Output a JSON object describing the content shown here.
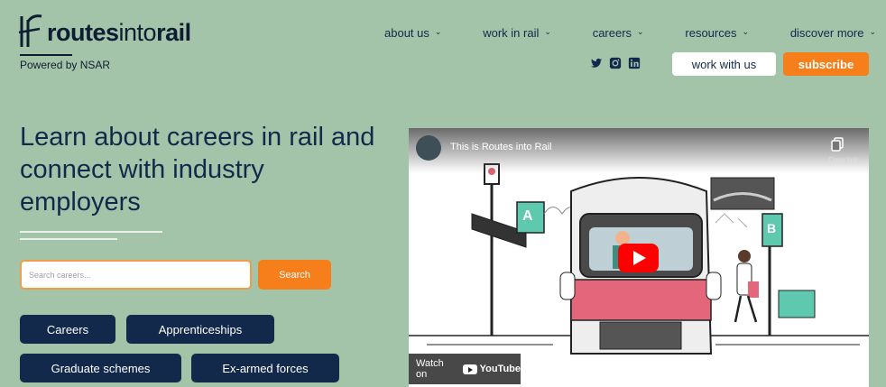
{
  "brand": {
    "name_bold_1": "routes",
    "name_thin": "into",
    "name_bold_2": "rail",
    "powered_by": "Powered by NSAR"
  },
  "nav": {
    "items": [
      {
        "label": "about us"
      },
      {
        "label": "work in rail"
      },
      {
        "label": "careers"
      },
      {
        "label": "resources"
      },
      {
        "label": "discover more"
      }
    ],
    "chevron": "⌄"
  },
  "social": [
    "twitter-icon",
    "instagram-icon",
    "linkedin-icon"
  ],
  "header_buttons": {
    "work_with_us": "work with us",
    "subscribe": "subscribe"
  },
  "hero": {
    "title": "Learn about careers in rail and connect with industry employers"
  },
  "search": {
    "placeholder": "Search careers...",
    "button": "Search"
  },
  "chips": [
    "Careers",
    "Apprenticeships",
    "Graduate schemes",
    "Ex-armed forces"
  ],
  "video": {
    "title": "This is Routes into Rail",
    "copy_label": "Copy link",
    "watch_on": "Watch on",
    "youtube": "YouTube",
    "sign_a": "A",
    "sign_b": "B"
  },
  "colors": {
    "background": "#a3c4a8",
    "navy": "#13294b",
    "orange": "#f77f1b",
    "play_red": "#ff0000"
  }
}
